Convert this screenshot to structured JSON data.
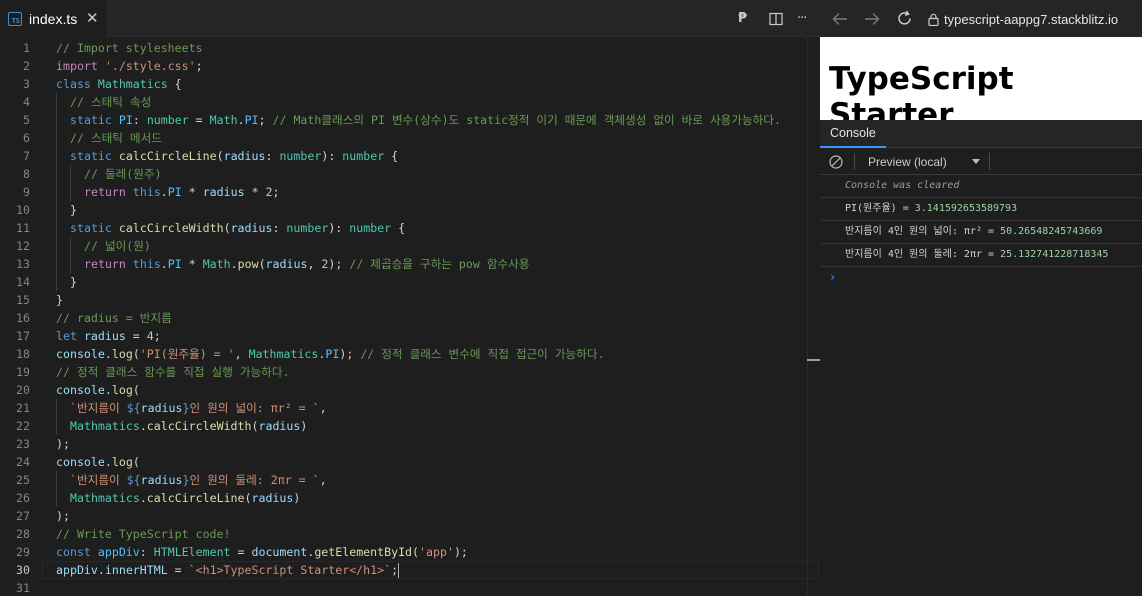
{
  "editor": {
    "tab": {
      "icon": "typescript-file-icon",
      "icon_text": "TS",
      "title": "index.ts",
      "close": "✕"
    },
    "actions": {
      "pnpm": "₱",
      "split": "split-editor-icon",
      "more": "···"
    },
    "active_line": 30,
    "lines": [
      {
        "n": "1",
        "indent": 0,
        "tokens": [
          [
            "// Import stylesheets",
            "com"
          ]
        ]
      },
      {
        "n": "2",
        "indent": 0,
        "tokens": [
          [
            "import",
            "ctl"
          ],
          [
            " ",
            "pl"
          ],
          [
            "'./style.css'",
            "str"
          ],
          [
            ";",
            "pl"
          ]
        ]
      },
      {
        "n": "3",
        "indent": 0,
        "tokens": [
          [
            "class",
            "kw"
          ],
          [
            " ",
            "pl"
          ],
          [
            "Mathmatics",
            "cls"
          ],
          [
            " {",
            "pl"
          ]
        ]
      },
      {
        "n": "4",
        "indent": 1,
        "tokens": [
          [
            "// 스태틱 속성",
            "com"
          ]
        ]
      },
      {
        "n": "5",
        "indent": 1,
        "tokens": [
          [
            "static",
            "kw"
          ],
          [
            " ",
            "pl"
          ],
          [
            "PI",
            "prop"
          ],
          [
            ": ",
            "pl"
          ],
          [
            "number",
            "cls"
          ],
          [
            " = ",
            "pl"
          ],
          [
            "Math",
            "cls"
          ],
          [
            ".",
            "pl"
          ],
          [
            "PI",
            "prop"
          ],
          [
            "; ",
            "pl"
          ],
          [
            "// Math클래스의 PI 변수(상수)도 static정적 이기 때문에 객체생성 없이 바로 사용가능하다.",
            "com"
          ]
        ]
      },
      {
        "n": "6",
        "indent": 1,
        "tokens": [
          [
            "// 스태틱 메서드",
            "com"
          ]
        ]
      },
      {
        "n": "7",
        "indent": 1,
        "tokens": [
          [
            "static",
            "kw"
          ],
          [
            " ",
            "pl"
          ],
          [
            "calcCircleLine",
            "fn"
          ],
          [
            "(",
            "pl"
          ],
          [
            "radius",
            "var"
          ],
          [
            ": ",
            "pl"
          ],
          [
            "number",
            "cls"
          ],
          [
            "): ",
            "pl"
          ],
          [
            "number",
            "cls"
          ],
          [
            " {",
            "pl"
          ]
        ]
      },
      {
        "n": "8",
        "indent": 2,
        "tokens": [
          [
            "// 둘레(원주)",
            "com"
          ]
        ]
      },
      {
        "n": "9",
        "indent": 2,
        "tokens": [
          [
            "return",
            "ctl"
          ],
          [
            " ",
            "pl"
          ],
          [
            "this",
            "kw"
          ],
          [
            ".",
            "pl"
          ],
          [
            "PI",
            "prop"
          ],
          [
            " * ",
            "pl"
          ],
          [
            "radius",
            "var"
          ],
          [
            " * ",
            "pl"
          ],
          [
            "2",
            "num"
          ],
          [
            ";",
            "pl"
          ]
        ]
      },
      {
        "n": "10",
        "indent": 1,
        "tokens": [
          [
            "}",
            "pl"
          ]
        ]
      },
      {
        "n": "11",
        "indent": 1,
        "tokens": [
          [
            "static",
            "kw"
          ],
          [
            " ",
            "pl"
          ],
          [
            "calcCircleWidth",
            "fn"
          ],
          [
            "(",
            "pl"
          ],
          [
            "radius",
            "var"
          ],
          [
            ": ",
            "pl"
          ],
          [
            "number",
            "cls"
          ],
          [
            "): ",
            "pl"
          ],
          [
            "number",
            "cls"
          ],
          [
            " {",
            "pl"
          ]
        ]
      },
      {
        "n": "12",
        "indent": 2,
        "tokens": [
          [
            "// 넓이(원)",
            "com"
          ]
        ]
      },
      {
        "n": "13",
        "indent": 2,
        "tokens": [
          [
            "return",
            "ctl"
          ],
          [
            " ",
            "pl"
          ],
          [
            "this",
            "kw"
          ],
          [
            ".",
            "pl"
          ],
          [
            "PI",
            "prop"
          ],
          [
            " * ",
            "pl"
          ],
          [
            "Math",
            "cls"
          ],
          [
            ".",
            "pl"
          ],
          [
            "pow",
            "fn"
          ],
          [
            "(",
            "pl"
          ],
          [
            "radius",
            "var"
          ],
          [
            ", ",
            "pl"
          ],
          [
            "2",
            "num"
          ],
          [
            "); ",
            "pl"
          ],
          [
            "// 제곱승을 구하는 pow 함수사용",
            "com"
          ]
        ]
      },
      {
        "n": "14",
        "indent": 1,
        "tokens": [
          [
            "}",
            "pl"
          ]
        ]
      },
      {
        "n": "15",
        "indent": 0,
        "tokens": [
          [
            "}",
            "pl"
          ]
        ]
      },
      {
        "n": "16",
        "indent": 0,
        "tokens": [
          [
            "// radius = 반지름",
            "com"
          ]
        ]
      },
      {
        "n": "17",
        "indent": 0,
        "tokens": [
          [
            "let",
            "kw"
          ],
          [
            " ",
            "pl"
          ],
          [
            "radius",
            "var"
          ],
          [
            " = ",
            "pl"
          ],
          [
            "4",
            "num"
          ],
          [
            ";",
            "pl"
          ]
        ]
      },
      {
        "n": "18",
        "indent": 0,
        "tokens": [
          [
            "console",
            "var"
          ],
          [
            ".",
            "pl"
          ],
          [
            "log",
            "fn"
          ],
          [
            "(",
            "pl"
          ],
          [
            "'PI(원주율) = '",
            "str"
          ],
          [
            ", ",
            "pl"
          ],
          [
            "Mathmatics",
            "cls"
          ],
          [
            ".",
            "pl"
          ],
          [
            "PI",
            "prop"
          ],
          [
            "); ",
            "pl"
          ],
          [
            "// 정적 클래스 변수에 직접 접근이 가능하다.",
            "com"
          ]
        ]
      },
      {
        "n": "19",
        "indent": 0,
        "tokens": [
          [
            "// 정적 클래스 함수를 직접 실행 가능하다.",
            "com"
          ]
        ]
      },
      {
        "n": "20",
        "indent": 0,
        "tokens": [
          [
            "console",
            "var"
          ],
          [
            ".",
            "pl"
          ],
          [
            "log",
            "fn"
          ],
          [
            "(",
            "pl"
          ]
        ]
      },
      {
        "n": "21",
        "indent": 1,
        "tokens": [
          [
            "`반지름이 ",
            "str"
          ],
          [
            "${",
            "kw"
          ],
          [
            "radius",
            "var"
          ],
          [
            "}",
            "kw"
          ],
          [
            "인 원의 넓이: πr² = `",
            "str"
          ],
          [
            ",",
            "pl"
          ]
        ]
      },
      {
        "n": "22",
        "indent": 1,
        "tokens": [
          [
            "Mathmatics",
            "cls"
          ],
          [
            ".",
            "pl"
          ],
          [
            "calcCircleWidth",
            "fn"
          ],
          [
            "(",
            "pl"
          ],
          [
            "radius",
            "var"
          ],
          [
            ")",
            "pl"
          ]
        ]
      },
      {
        "n": "23",
        "indent": 0,
        "tokens": [
          [
            ");",
            "pl"
          ]
        ]
      },
      {
        "n": "24",
        "indent": 0,
        "tokens": [
          [
            "console",
            "var"
          ],
          [
            ".",
            "pl"
          ],
          [
            "log",
            "fn"
          ],
          [
            "(",
            "pl"
          ]
        ]
      },
      {
        "n": "25",
        "indent": 1,
        "tokens": [
          [
            "`반지름이 ",
            "str"
          ],
          [
            "${",
            "kw"
          ],
          [
            "radius",
            "var"
          ],
          [
            "}",
            "kw"
          ],
          [
            "인 원의 둘레: 2πr = `",
            "str"
          ],
          [
            ",",
            "pl"
          ]
        ]
      },
      {
        "n": "26",
        "indent": 1,
        "tokens": [
          [
            "Mathmatics",
            "cls"
          ],
          [
            ".",
            "pl"
          ],
          [
            "calcCircleLine",
            "fn"
          ],
          [
            "(",
            "pl"
          ],
          [
            "radius",
            "var"
          ],
          [
            ")",
            "pl"
          ]
        ]
      },
      {
        "n": "27",
        "indent": 0,
        "tokens": [
          [
            ");",
            "pl"
          ]
        ]
      },
      {
        "n": "28",
        "indent": 0,
        "tokens": [
          [
            "// Write TypeScript code!",
            "com"
          ]
        ]
      },
      {
        "n": "29",
        "indent": 0,
        "tokens": [
          [
            "const",
            "kw"
          ],
          [
            " ",
            "pl"
          ],
          [
            "appDiv",
            "prop"
          ],
          [
            ": ",
            "pl"
          ],
          [
            "HTMLElement",
            "cls"
          ],
          [
            " = ",
            "pl"
          ],
          [
            "document",
            "var"
          ],
          [
            ".",
            "pl"
          ],
          [
            "getElementById",
            "fn"
          ],
          [
            "(",
            "pl"
          ],
          [
            "'app'",
            "str"
          ],
          [
            ");",
            "pl"
          ]
        ]
      },
      {
        "n": "30",
        "indent": 0,
        "tokens": [
          [
            "appDiv",
            "var"
          ],
          [
            ".",
            "pl"
          ],
          [
            "innerHTML",
            "var"
          ],
          [
            " = ",
            "pl"
          ],
          [
            "`<h1>TypeScript Starter</h1>`",
            "str"
          ],
          [
            ";",
            "pl"
          ]
        ]
      },
      {
        "n": "31",
        "indent": 0,
        "tokens": []
      }
    ]
  },
  "preview": {
    "url": "typescript-aappg7.stackblitz.io",
    "page_heading": "TypeScript Starter",
    "console": {
      "tab_label": "Console",
      "context": "Preview (local)",
      "messages": [
        {
          "text": "Console was cleared",
          "num": "",
          "kind": "info"
        },
        {
          "text": "PI(원주율) = ",
          "num": "3.141592653589793",
          "kind": "log"
        },
        {
          "text": "반지름이 4인 원의 넓이: πr² = ",
          "num": "50.26548245743669",
          "kind": "log"
        },
        {
          "text": "반지름이 4인 원의 둘레: 2πr = ",
          "num": "25.132741228718345",
          "kind": "log"
        }
      ],
      "prompt": "›"
    }
  },
  "colors": {
    "editor_bg": "#1e1e1e",
    "tabbar_bg": "#252526",
    "comment": "#6a9955",
    "keyword": "#569cd6",
    "string": "#ce9178",
    "type": "#4ec9b0",
    "function": "#dcdcaa",
    "variable": "#9cdcfe",
    "accent": "#3794ff"
  }
}
